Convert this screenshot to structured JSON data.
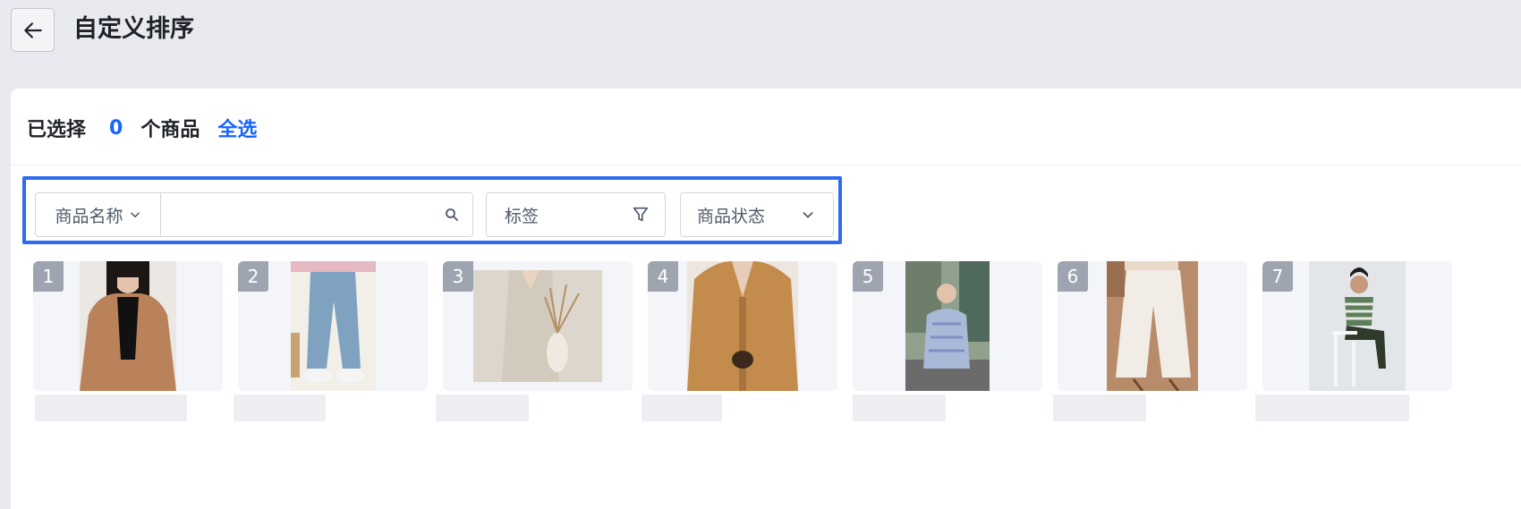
{
  "header": {
    "title": "自定义排序",
    "back_icon": "arrow-left-icon"
  },
  "selection": {
    "prefix": "已选择",
    "count": "0",
    "suffix": "个商品",
    "select_all": "全选"
  },
  "filters": {
    "name_field_selector": "商品名称",
    "search_value": "",
    "tag_label": "标签",
    "status_label": "商品状态"
  },
  "products": [
    {
      "index": "1",
      "image": "woman-camel-blazer-photo"
    },
    {
      "index": "2",
      "image": "blue-jeans-sneakers-photo"
    },
    {
      "index": "3",
      "image": "linen-dress-vase-photo"
    },
    {
      "index": "4",
      "image": "camel-knit-cardigan-photo"
    },
    {
      "index": "5",
      "image": "patterned-cardigan-street-photo"
    },
    {
      "index": "6",
      "image": "white-wide-pants-photo"
    },
    {
      "index": "7",
      "image": "striped-tee-chair-photo"
    }
  ],
  "colors": {
    "accent": "#1664ff",
    "highlight_border": "#2f6bf0",
    "badge": "#9ea4b0",
    "page_bg": "#e8eaef"
  }
}
